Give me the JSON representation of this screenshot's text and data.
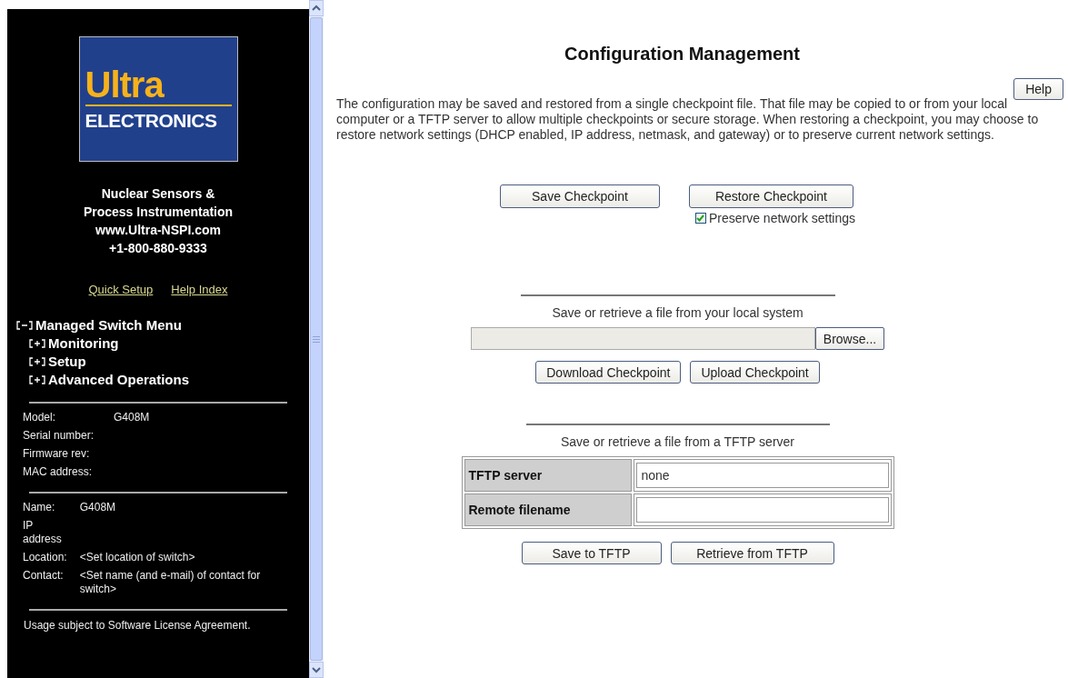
{
  "logo": {
    "word_top": "Ultra",
    "word_bottom": "ELECTRONICS"
  },
  "org_lines": [
    "Nuclear Sensors &",
    "Process Instrumentation",
    "www.Ultra-NSPI.com",
    "+1-800-880-9333"
  ],
  "links": [
    "Quick Setup",
    "Help Index"
  ],
  "menu": {
    "label": "Managed Switch Menu",
    "expanded": true,
    "children": [
      {
        "label": "Monitoring",
        "expanded": false
      },
      {
        "label": "Setup",
        "expanded": false
      },
      {
        "label": "Advanced Operations",
        "expanded": false
      }
    ]
  },
  "device_info": [
    {
      "label": "Model:",
      "value": "G408M"
    },
    {
      "label": "Serial number:"
    },
    {
      "label": "Firmware rev:"
    },
    {
      "label": "MAC address:"
    }
  ],
  "switch_info": [
    {
      "label": "Name:",
      "value": "G408M"
    },
    {
      "label": "IP address"
    },
    {
      "label": "Location:",
      "value": "<Set location of switch>"
    },
    {
      "label": "Contact:",
      "value": "<Set name (and e-mail) of contact for switch>"
    }
  ],
  "footer": "Usage subject to Software License Agreement.",
  "title": "Configuration Management",
  "help_button": "Help",
  "description": "The configuration may be saved and restored from a single checkpoint file. That file may be copied to or from your local computer or a TFTP server to allow multiple checkpoints or secure storage. When restoring a checkpoint, you may choose to restore network settings (DHCP enabled, IP address, netmask, and gateway) or to preserve current network settings.",
  "checkpoint": {
    "save_button": "Save Checkpoint",
    "restore_button": "Restore Checkpoint",
    "preserve": {
      "label": "Preserve network settings",
      "checked": true
    }
  },
  "local": {
    "heading": "Save or retrieve a file from your local system",
    "browse_button": "Browse...",
    "download_button": "Download Checkpoint",
    "upload_button": "Upload Checkpoint"
  },
  "tftp": {
    "heading": "Save or retrieve a file from a TFTP server",
    "fields": [
      {
        "label": "TFTP server",
        "value": "none"
      },
      {
        "label": "Remote filename"
      }
    ],
    "save_button": "Save to TFTP",
    "retrieve_button": "Retrieve from TFTP"
  }
}
